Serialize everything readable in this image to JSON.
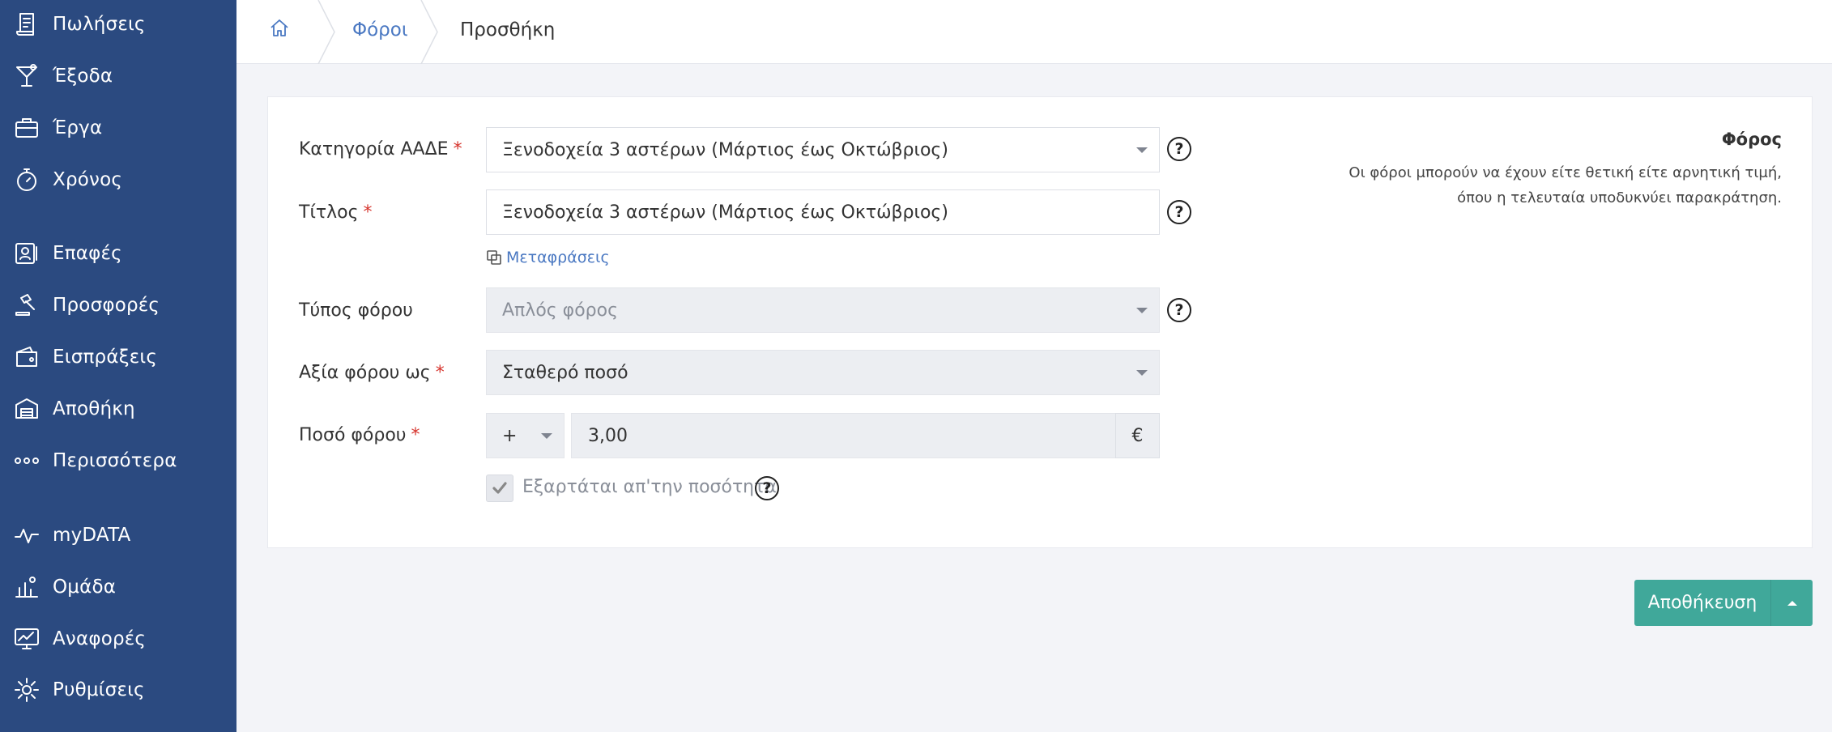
{
  "sidebar": {
    "items": [
      {
        "label": "Πωλήσεις",
        "icon": "receipt-icon"
      },
      {
        "label": "Έξοδα",
        "icon": "cocktail-icon"
      },
      {
        "label": "Έργα",
        "icon": "briefcase-icon"
      },
      {
        "label": "Χρόνος",
        "icon": "stopwatch-icon"
      },
      {
        "label": "Επαφές",
        "icon": "contact-card-icon"
      },
      {
        "label": "Προσφορές",
        "icon": "gavel-icon"
      },
      {
        "label": "Εισπράξεις",
        "icon": "wallet-icon"
      },
      {
        "label": "Αποθήκη",
        "icon": "warehouse-icon"
      },
      {
        "label": "Περισσότερα",
        "icon": "more-dots-icon"
      },
      {
        "label": "myDATA",
        "icon": "pulse-icon"
      },
      {
        "label": "Ομάδα",
        "icon": "team-chart-icon"
      },
      {
        "label": "Αναφορές",
        "icon": "monitor-chart-icon"
      },
      {
        "label": "Ρυθμίσεις",
        "icon": "gear-icon"
      }
    ]
  },
  "breadcrumb": {
    "home_icon": "home-icon",
    "parent": "Φόροι",
    "current": "Προσθήκη"
  },
  "form": {
    "required_mark": "*",
    "category": {
      "label": "Κατηγορία ΑΑΔΕ",
      "value": "Ξενοδοχεία 3 αστέρων (Μάρτιος έως Οκτώβριος)"
    },
    "title": {
      "label": "Τίτλος",
      "value": "Ξενοδοχεία 3 αστέρων (Μάρτιος έως Οκτώβριος)"
    },
    "translations_link": "Μεταφράσεις",
    "tax_type": {
      "label": "Τύπος φόρου",
      "value": "Απλός φόρος"
    },
    "value_as": {
      "label": "Αξία φόρου ως",
      "value": "Σταθερό ποσό"
    },
    "amount": {
      "label": "Ποσό φόρου",
      "sign": "+",
      "value": "3,00",
      "unit": "€"
    },
    "depends_on_quantity": {
      "label": "Εξαρτάται απ'την ποσότητα",
      "checked": true
    },
    "help_glyph": "?"
  },
  "info": {
    "title": "Φόρος",
    "text": "Οι φόροι μπορούν να έχουν είτε θετική είτε αρνητική τιμή, όπου η τελευταία υποδυκνύει παρακράτηση."
  },
  "actions": {
    "save_label": "Αποθήκευση"
  },
  "colors": {
    "sidebar_bg": "#2b4a80",
    "link": "#4a78c2",
    "save_button": "#40a89a",
    "required": "#d6342d"
  }
}
